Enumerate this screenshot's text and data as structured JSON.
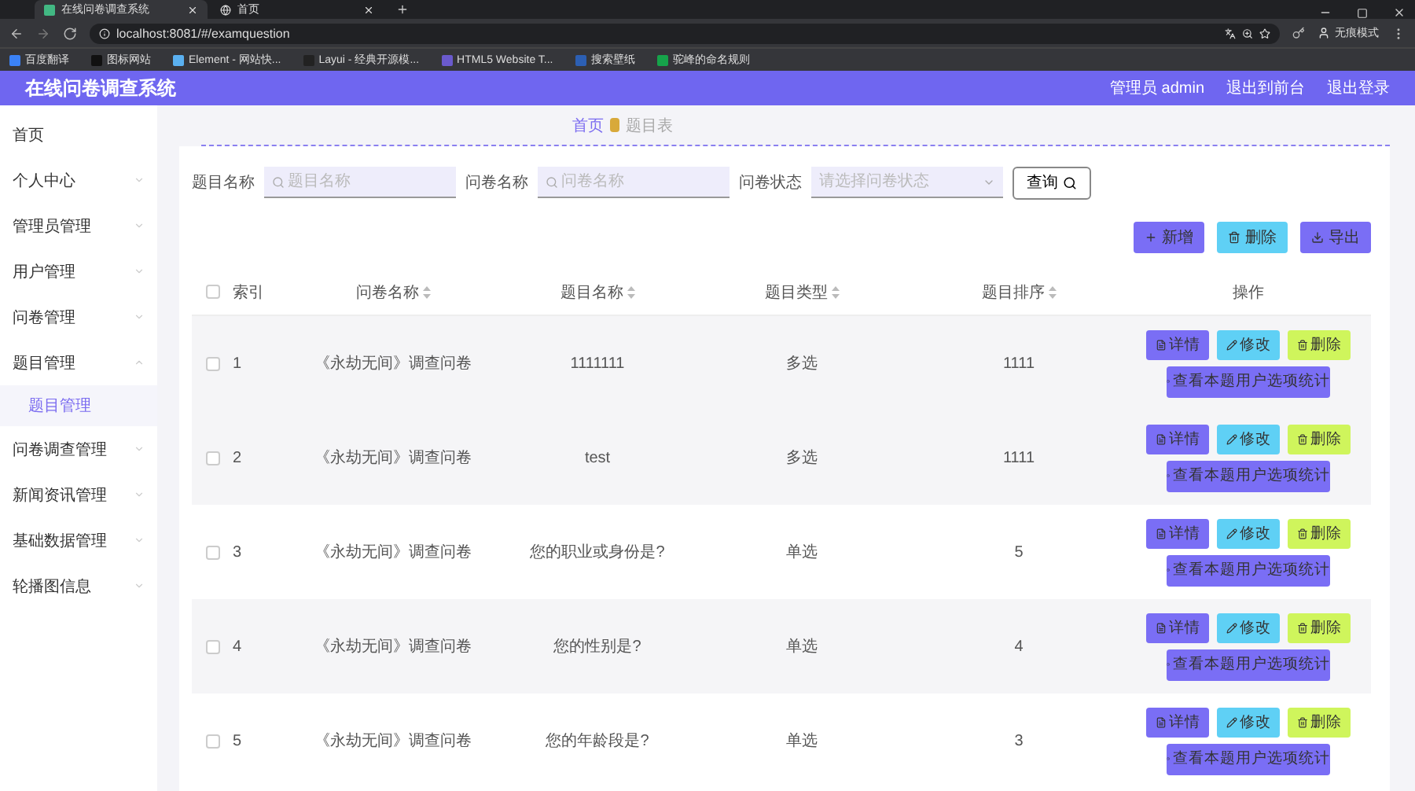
{
  "browser": {
    "tabs": [
      {
        "title": "在线问卷调查系统",
        "selected": true
      },
      {
        "title": "首页",
        "selected": false
      }
    ],
    "url": "localhost:8081/#/examquestion",
    "bookmarks": [
      "百度翻译",
      "图标网站",
      "Element - 网站快...",
      "Layui - 经典开源模...",
      "HTML5 Website T...",
      "搜索壁纸",
      "驼峰的命名规则"
    ],
    "profile": "无痕模式"
  },
  "header": {
    "title": "在线问卷调查系统",
    "user": "管理员 admin",
    "links": [
      "退出到前台",
      "退出登录"
    ]
  },
  "sidebar": {
    "items": [
      {
        "label": "首页",
        "expandable": false
      },
      {
        "label": "个人中心",
        "expandable": true
      },
      {
        "label": "管理员管理",
        "expandable": true
      },
      {
        "label": "用户管理",
        "expandable": true
      },
      {
        "label": "问卷管理",
        "expandable": true
      },
      {
        "label": "题目管理",
        "expandable": true,
        "children": [
          {
            "label": "题目管理",
            "selected": true
          }
        ]
      },
      {
        "label": "问卷调查管理",
        "expandable": true
      },
      {
        "label": "新闻资讯管理",
        "expandable": true
      },
      {
        "label": "基础数据管理",
        "expandable": true
      },
      {
        "label": "轮播图信息",
        "expandable": true
      }
    ]
  },
  "breadcrumb": [
    "首页",
    "题目表"
  ],
  "filters": [
    {
      "label": "题目名称",
      "placeholder": "题目名称",
      "kind": "search"
    },
    {
      "label": "问卷名称",
      "placeholder": "问卷名称",
      "kind": "search"
    },
    {
      "label": "问卷状态",
      "placeholder": "请选择问卷状态",
      "kind": "select"
    }
  ],
  "search_button": "查询",
  "actions": [
    {
      "label": "新增",
      "kind": "add"
    },
    {
      "label": "删除",
      "kind": "delete"
    },
    {
      "label": "导出",
      "kind": "export"
    }
  ],
  "table": {
    "select_all_checked": false,
    "columns": [
      {
        "label": "索引",
        "sortable": false
      },
      {
        "label": "问卷名称",
        "sortable": true
      },
      {
        "label": "题目名称",
        "sortable": true
      },
      {
        "label": "题目类型",
        "sortable": true
      },
      {
        "label": "题目排序",
        "sortable": true
      },
      {
        "label": "操作",
        "sortable": false
      }
    ],
    "rows": [
      {
        "checked": false,
        "index": "1",
        "survey": "《永劫无间》调查问卷",
        "question": "1111111",
        "type": "多选",
        "order": "1111",
        "buttons": [
          "详情",
          "修改",
          "删除"
        ],
        "stats_button": "查看本题用户选项统计"
      },
      {
        "checked": false,
        "index": "2",
        "survey": "《永劫无间》调查问卷",
        "question": "test",
        "type": "多选",
        "order": "1111",
        "buttons": [
          "详情",
          "修改",
          "删除"
        ],
        "stats_button": "查看本题用户选项统计"
      },
      {
        "checked": false,
        "index": "3",
        "survey": "《永劫无间》调查问卷",
        "question": "您的职业或身份是?",
        "type": "单选",
        "order": "5",
        "buttons": [
          "详情",
          "修改",
          "删除"
        ],
        "stats_button": "查看本题用户选项统计"
      },
      {
        "checked": false,
        "index": "4",
        "survey": "《永劫无间》调查问卷",
        "question": "您的性别是?",
        "type": "单选",
        "order": "4",
        "buttons": [
          "详情",
          "修改",
          "删除"
        ],
        "stats_button": "查看本题用户选项统计"
      },
      {
        "checked": false,
        "index": "5",
        "survey": "《永劫无间》调查问卷",
        "question": "您的年龄段是?",
        "type": "单选",
        "order": "3",
        "buttons": [
          "详情",
          "修改",
          "删除"
        ],
        "stats_button": "查看本题用户选项统计"
      }
    ]
  }
}
